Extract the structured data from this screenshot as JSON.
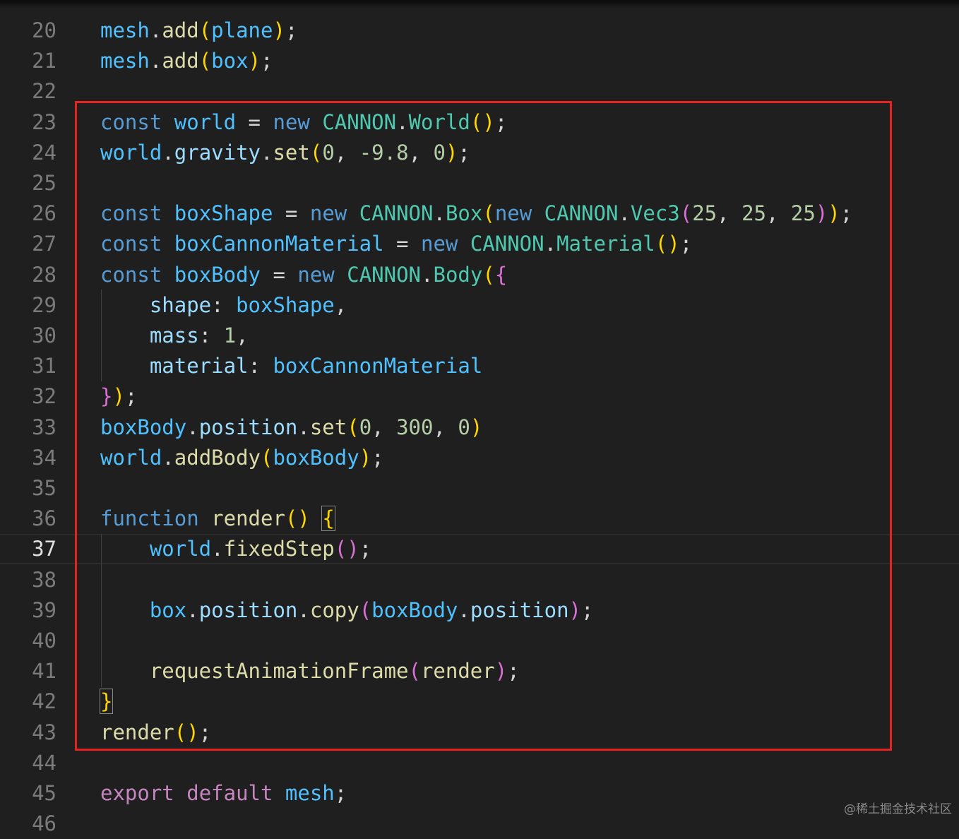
{
  "editor": {
    "lines": [
      {
        "num": "20",
        "tokens": [
          [
            "var",
            "mesh"
          ],
          [
            "pl",
            "."
          ],
          [
            "fn",
            "add"
          ],
          [
            "p1",
            "("
          ],
          [
            "var",
            "plane"
          ],
          [
            "p1",
            ")"
          ],
          [
            "pl",
            ";"
          ]
        ]
      },
      {
        "num": "21",
        "tokens": [
          [
            "var",
            "mesh"
          ],
          [
            "pl",
            "."
          ],
          [
            "fn",
            "add"
          ],
          [
            "p1",
            "("
          ],
          [
            "var",
            "box"
          ],
          [
            "p1",
            ")"
          ],
          [
            "pl",
            ";"
          ]
        ]
      },
      {
        "num": "22",
        "tokens": []
      },
      {
        "num": "23",
        "tokens": [
          [
            "kw",
            "const"
          ],
          [
            "pl",
            " "
          ],
          [
            "var",
            "world"
          ],
          [
            "pl",
            " = "
          ],
          [
            "kw",
            "new"
          ],
          [
            "pl",
            " "
          ],
          [
            "cls",
            "CANNON"
          ],
          [
            "pl",
            "."
          ],
          [
            "cls",
            "World"
          ],
          [
            "p1",
            "()"
          ],
          [
            "pl",
            ";"
          ]
        ]
      },
      {
        "num": "24",
        "tokens": [
          [
            "var",
            "world"
          ],
          [
            "pl",
            "."
          ],
          [
            "prop",
            "gravity"
          ],
          [
            "pl",
            "."
          ],
          [
            "fn",
            "set"
          ],
          [
            "p1",
            "("
          ],
          [
            "num",
            "0"
          ],
          [
            "pl",
            ", "
          ],
          [
            "num",
            "-9.8"
          ],
          [
            "pl",
            ", "
          ],
          [
            "num",
            "0"
          ],
          [
            "p1",
            ")"
          ],
          [
            "pl",
            ";"
          ]
        ]
      },
      {
        "num": "25",
        "tokens": []
      },
      {
        "num": "26",
        "tokens": [
          [
            "kw",
            "const"
          ],
          [
            "pl",
            " "
          ],
          [
            "var",
            "boxShape"
          ],
          [
            "pl",
            " = "
          ],
          [
            "kw",
            "new"
          ],
          [
            "pl",
            " "
          ],
          [
            "cls",
            "CANNON"
          ],
          [
            "pl",
            "."
          ],
          [
            "cls",
            "Box"
          ],
          [
            "p1",
            "("
          ],
          [
            "kw",
            "new"
          ],
          [
            "pl",
            " "
          ],
          [
            "cls",
            "CANNON"
          ],
          [
            "pl",
            "."
          ],
          [
            "cls",
            "Vec3"
          ],
          [
            "p2",
            "("
          ],
          [
            "num",
            "25"
          ],
          [
            "pl",
            ", "
          ],
          [
            "num",
            "25"
          ],
          [
            "pl",
            ", "
          ],
          [
            "num",
            "25"
          ],
          [
            "p2",
            ")"
          ],
          [
            "p1",
            ")"
          ],
          [
            "pl",
            ";"
          ]
        ]
      },
      {
        "num": "27",
        "tokens": [
          [
            "kw",
            "const"
          ],
          [
            "pl",
            " "
          ],
          [
            "var",
            "boxCannonMaterial"
          ],
          [
            "pl",
            " = "
          ],
          [
            "kw",
            "new"
          ],
          [
            "pl",
            " "
          ],
          [
            "cls",
            "CANNON"
          ],
          [
            "pl",
            "."
          ],
          [
            "cls",
            "Material"
          ],
          [
            "p1",
            "()"
          ],
          [
            "pl",
            ";"
          ]
        ]
      },
      {
        "num": "28",
        "tokens": [
          [
            "kw",
            "const"
          ],
          [
            "pl",
            " "
          ],
          [
            "var",
            "boxBody"
          ],
          [
            "pl",
            " = "
          ],
          [
            "kw",
            "new"
          ],
          [
            "pl",
            " "
          ],
          [
            "cls",
            "CANNON"
          ],
          [
            "pl",
            "."
          ],
          [
            "cls",
            "Body"
          ],
          [
            "p1",
            "("
          ],
          [
            "p2",
            "{"
          ]
        ]
      },
      {
        "num": "29",
        "tokens": [
          [
            "pl",
            "    "
          ],
          [
            "prop",
            "shape"
          ],
          [
            "pl",
            ": "
          ],
          [
            "var",
            "boxShape"
          ],
          [
            "pl",
            ","
          ]
        ]
      },
      {
        "num": "30",
        "tokens": [
          [
            "pl",
            "    "
          ],
          [
            "prop",
            "mass"
          ],
          [
            "pl",
            ": "
          ],
          [
            "num",
            "1"
          ],
          [
            "pl",
            ","
          ]
        ]
      },
      {
        "num": "31",
        "tokens": [
          [
            "pl",
            "    "
          ],
          [
            "prop",
            "material"
          ],
          [
            "pl",
            ": "
          ],
          [
            "var",
            "boxCannonMaterial"
          ]
        ]
      },
      {
        "num": "32",
        "tokens": [
          [
            "p2",
            "}"
          ],
          [
            "p1",
            ")"
          ],
          [
            "pl",
            ";"
          ]
        ]
      },
      {
        "num": "33",
        "tokens": [
          [
            "var",
            "boxBody"
          ],
          [
            "pl",
            "."
          ],
          [
            "prop",
            "position"
          ],
          [
            "pl",
            "."
          ],
          [
            "fn",
            "set"
          ],
          [
            "p1",
            "("
          ],
          [
            "num",
            "0"
          ],
          [
            "pl",
            ", "
          ],
          [
            "num",
            "300"
          ],
          [
            "pl",
            ", "
          ],
          [
            "num",
            "0"
          ],
          [
            "p1",
            ")"
          ]
        ]
      },
      {
        "num": "34",
        "tokens": [
          [
            "var",
            "world"
          ],
          [
            "pl",
            "."
          ],
          [
            "fn",
            "addBody"
          ],
          [
            "p1",
            "("
          ],
          [
            "var",
            "boxBody"
          ],
          [
            "p1",
            ")"
          ],
          [
            "pl",
            ";"
          ]
        ]
      },
      {
        "num": "35",
        "tokens": []
      },
      {
        "num": "36",
        "tokens": [
          [
            "kw",
            "function"
          ],
          [
            "pl",
            " "
          ],
          [
            "fn",
            "render"
          ],
          [
            "p1",
            "()"
          ],
          [
            "pl",
            " "
          ],
          [
            "p1 match",
            "{"
          ]
        ]
      },
      {
        "num": "37",
        "current": true,
        "tokens": [
          [
            "pl",
            "    "
          ],
          [
            "var",
            "world"
          ],
          [
            "pl",
            "."
          ],
          [
            "fn",
            "fixedStep"
          ],
          [
            "p2",
            "()"
          ],
          [
            "pl",
            ";"
          ]
        ]
      },
      {
        "num": "38",
        "tokens": []
      },
      {
        "num": "39",
        "tokens": [
          [
            "pl",
            "    "
          ],
          [
            "var",
            "box"
          ],
          [
            "pl",
            "."
          ],
          [
            "prop",
            "position"
          ],
          [
            "pl",
            "."
          ],
          [
            "fn",
            "copy"
          ],
          [
            "p2",
            "("
          ],
          [
            "var",
            "boxBody"
          ],
          [
            "pl",
            "."
          ],
          [
            "prop",
            "position"
          ],
          [
            "p2",
            ")"
          ],
          [
            "pl",
            ";"
          ]
        ]
      },
      {
        "num": "40",
        "tokens": []
      },
      {
        "num": "41",
        "tokens": [
          [
            "pl",
            "    "
          ],
          [
            "fn",
            "requestAnimationFrame"
          ],
          [
            "p2",
            "("
          ],
          [
            "fn",
            "render"
          ],
          [
            "p2",
            ")"
          ],
          [
            "pl",
            ";"
          ]
        ]
      },
      {
        "num": "42",
        "tokens": [
          [
            "p1 match",
            "}"
          ]
        ]
      },
      {
        "num": "43",
        "tokens": [
          [
            "fn",
            "render"
          ],
          [
            "p1",
            "()"
          ],
          [
            "pl",
            ";"
          ]
        ]
      },
      {
        "num": "44",
        "tokens": []
      },
      {
        "num": "45",
        "tokens": [
          [
            "ctl",
            "export"
          ],
          [
            "pl",
            " "
          ],
          [
            "ctl",
            "default"
          ],
          [
            "pl",
            " "
          ],
          [
            "var",
            "mesh"
          ],
          [
            "pl",
            ";"
          ]
        ]
      },
      {
        "num": "46",
        "tokens": []
      }
    ]
  },
  "highlight": {
    "color": "#e8231f"
  },
  "watermark": "@稀土掘金技术社区"
}
